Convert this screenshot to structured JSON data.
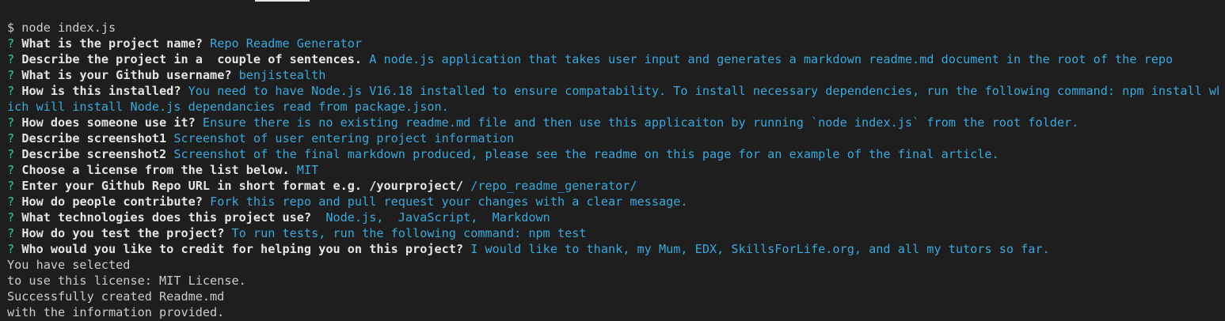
{
  "command": "$ node index.js",
  "qmark": "?",
  "prompts": [
    {
      "label": "What is the project name?",
      "answer": "Repo Readme Generator"
    },
    {
      "label": "Describe the project in a  couple of sentences.",
      "answer": "A node.js application that takes user input and generates a markdown readme.md document in the root of the repo"
    },
    {
      "label": "What is your Github username?",
      "answer": "benjistealth"
    },
    {
      "label": "How is this installed?",
      "answer": "You need to have Node.js V16.18 installed to ensure compatability. To install necessary dependencies, run the following command: npm install wh",
      "answer_cont": "ich will install Node.js dependancies read from package.json."
    },
    {
      "label": "How does someone use it?",
      "answer": "Ensure there is no existing readme.md file and then use this applicaiton by running `node index.js` from the root folder."
    },
    {
      "label": "Describe screenshot1",
      "answer": "Screenshot of user entering project information"
    },
    {
      "label": "Describe screenshot2",
      "answer": "Screenshot of the final markdown produced, please see the readme on this page for an example of the final article."
    },
    {
      "label": "Choose a license from the list below.",
      "answer": "MIT"
    },
    {
      "label": "Enter your Github Repo URL in short format e.g. /yourproject/",
      "answer": "/repo_readme_generator/"
    },
    {
      "label": "How do people contribute?",
      "answer": "Fork this repo and pull request your changes with a clear message."
    },
    {
      "label": "What technologies does this project use?",
      "answer": " Node.js,  JavaScript,  Markdown"
    },
    {
      "label": "How do you test the project?",
      "answer": "To run tests, run the following command: npm test"
    },
    {
      "label": "Who would you like to credit for helping you on this project?",
      "answer": "I would like to thank, my Mum, EDX, SkillsForLife.org, and all my tutors so far."
    }
  ],
  "output": [
    "You have selected",
    "to use this license: MIT License.",
    "Successfully created Readme.md",
    "with the information provided."
  ],
  "colors": {
    "background": "#1e1e1e",
    "question_mark": "#23d18b",
    "answer": "#3aa8dc",
    "text": "#cccccc"
  }
}
